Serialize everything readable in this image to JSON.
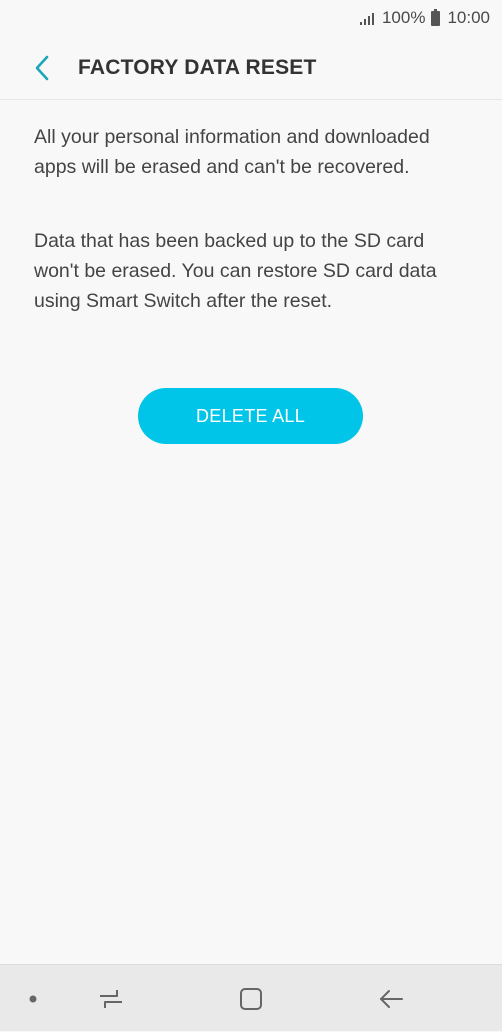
{
  "status_bar": {
    "battery": "100%",
    "time": "10:00"
  },
  "header": {
    "title": "FACTORY DATA RESET",
    "back_icon": "chevron-left-icon"
  },
  "content": {
    "paragraph_1": "All your personal information and downloaded apps will be erased and can't be recovered.",
    "paragraph_2": "Data that has been backed up to the SD card won't be erased. You can restore SD card data using Smart Switch after the reset."
  },
  "actions": {
    "delete_all_label": "DELETE ALL"
  },
  "nav_bar": {
    "items": [
      "dot-icon",
      "recent-apps-icon",
      "home-icon",
      "back-icon"
    ]
  },
  "colors": {
    "accent": "#00c4e8",
    "back_arrow": "#1aa6b7",
    "background": "#f8f8f8",
    "nav_background": "#e9e9e9"
  }
}
